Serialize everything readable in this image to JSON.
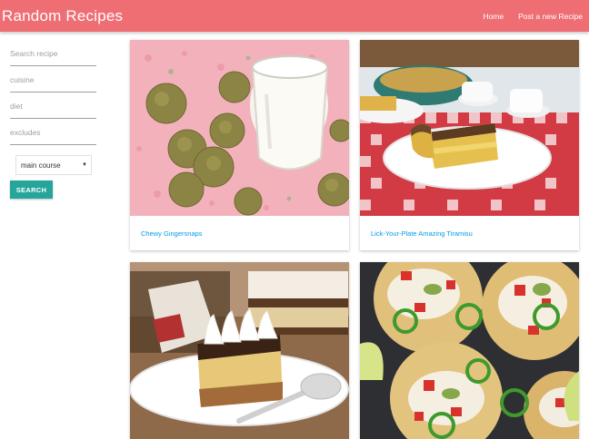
{
  "navbar": {
    "brand": "Random Recipes",
    "links": [
      "Home",
      "Post a new Recipe"
    ]
  },
  "sidebar": {
    "search_placeholder": "Search recipe",
    "cuisine_placeholder": "cuisine",
    "diet_placeholder": "diet",
    "excludes_placeholder": "excludes",
    "meal_type_selected": "main course",
    "search_button": "SEARCH"
  },
  "recipes": [
    {
      "title": "Chewy Gingersnaps"
    },
    {
      "title": "Lick-Your-Plate Amazing Tiramisu"
    },
    {
      "title": ""
    },
    {
      "title": ""
    }
  ],
  "colors": {
    "primary": "#ee6e73",
    "button": "#26a69a",
    "link": "#039be5"
  }
}
